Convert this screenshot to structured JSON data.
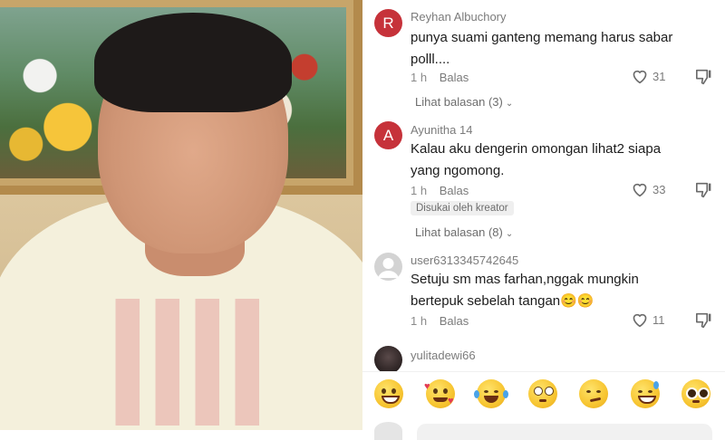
{
  "comments": [
    {
      "avatar_letter": "R",
      "avatar_color": "#c6323a",
      "username": "Reyhan Albuchory",
      "text": "punya suami ganteng memang harus sabar polll....",
      "time": "1 h",
      "reply_label": "Balas",
      "likes": "31",
      "view_replies": "Lihat balasan (3)"
    },
    {
      "avatar_letter": "A",
      "avatar_color": "#c6323a",
      "username": "Ayunitha 14",
      "text": "Kalau aku dengerin omongan lihat2 siapa yang ngomong.",
      "time": "1 h",
      "reply_label": "Balas",
      "likes": "33",
      "badge": "Disukai oleh kreator",
      "view_replies": "Lihat balasan (8)"
    },
    {
      "username": "user6313345742645",
      "text": "Setuju sm mas farhan,nggak mungkin bertepuk sebelah tangan😊😊",
      "time": "1 h",
      "reply_label": "Balas",
      "likes": "11"
    },
    {
      "username": "yulitadewi66"
    }
  ],
  "emoji_bar": [
    "😁",
    "🥰",
    "😂",
    "😳",
    "😏",
    "😅",
    "🥺"
  ],
  "colors": {
    "accent": "#c6323a",
    "muted": "#8a8a8a",
    "text": "#1c1c1c"
  }
}
